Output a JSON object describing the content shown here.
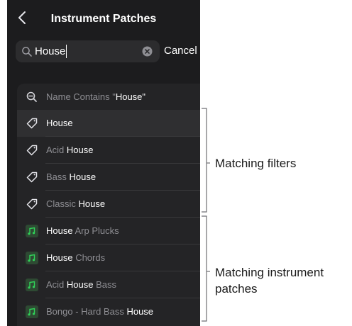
{
  "nav": {
    "back_glyph": "<",
    "title": "Instrument Patches"
  },
  "search": {
    "value": "House",
    "cancel_label": "Cancel"
  },
  "filter_query": {
    "prefix": "Name Contains \"",
    "term": "House",
    "suffix": "\""
  },
  "filters": [
    {
      "pre": "",
      "hl": "House",
      "post": "",
      "selected": true,
      "icon": "tag-icon"
    },
    {
      "pre": "Acid ",
      "hl": "House",
      "post": "",
      "selected": false,
      "icon": "tag-icon"
    },
    {
      "pre": "Bass ",
      "hl": "House",
      "post": "",
      "selected": false,
      "icon": "tag-icon"
    },
    {
      "pre": "Classic ",
      "hl": "House",
      "post": "",
      "selected": false,
      "icon": "tag-icon"
    }
  ],
  "patches": [
    {
      "pre": "",
      "hl": "House",
      "post": " Arp Plucks",
      "icon": "music-note-icon"
    },
    {
      "pre": "",
      "hl": "House",
      "post": " Chords",
      "icon": "music-note-icon"
    },
    {
      "pre": "Acid ",
      "hl": "House",
      "post": " Bass",
      "icon": "music-note-icon"
    },
    {
      "pre": "Bongo - Hard Bass ",
      "hl": "House",
      "post": "",
      "icon": "music-note-icon"
    }
  ],
  "callouts": {
    "filters": "Matching filters",
    "patches_line1": "Matching instrument",
    "patches_line2": "patches"
  },
  "colors": {
    "background": "#1c1c1e",
    "list": "#242426",
    "accent_green": "#30d158"
  }
}
